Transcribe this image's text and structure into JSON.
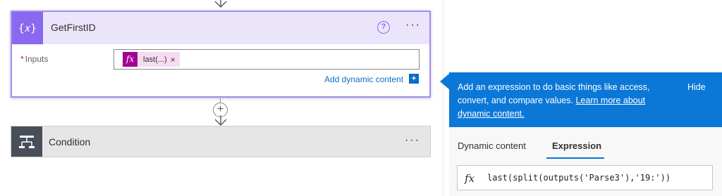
{
  "action": {
    "title": "GetFirstID",
    "icon": "variable-icon",
    "icon_glyph": "{𝑥}",
    "help_glyph": "?",
    "more_glyph": "···",
    "inputs_label": "Inputs",
    "required_mark": "*",
    "token": {
      "fx_glyph": "fx",
      "label": "last(...)",
      "close_glyph": "×"
    },
    "dynamic_content_link": "Add dynamic content",
    "dynamic_plus_glyph": "+"
  },
  "connector": {
    "plus_glyph": "+"
  },
  "condition": {
    "title": "Condition",
    "more_glyph": "···"
  },
  "panel": {
    "info_text": "Add an expression to do basic things like access, convert, and compare values.",
    "info_link": "Learn more about dynamic content.",
    "hide_label": "Hide",
    "tabs": [
      {
        "label": "Dynamic content",
        "selected": false
      },
      {
        "label": "Expression",
        "selected": true
      }
    ],
    "expression_fx_glyph": "fx",
    "expression_value": "last(split(outputs('Parse3'),'19:'))"
  },
  "colors": {
    "accent_purple": "#8a68f0",
    "header_purple": "#ebe5fc",
    "expression_magenta": "#a30095",
    "link_blue": "#0b6ec5",
    "info_blue": "#0b78d8",
    "condition_gray": "#484f58"
  }
}
